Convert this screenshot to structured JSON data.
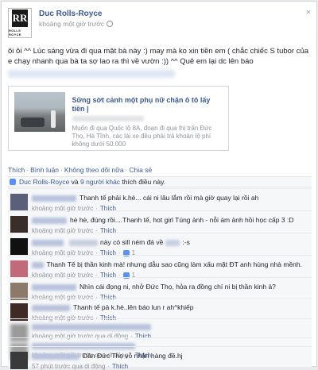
{
  "post": {
    "author": "Duc Rolls-Royce",
    "logo_text": "ROLLS ROYCE",
    "logo_monogram": "RR",
    "time": "khoảng một giờ trước",
    "close_glyph": "×",
    "text": "ôi ôi ^^ Lúc sáng vừa đi qua mặt bà này :) may mà ko xin tiền em ( chắc chiếc S tubor của e chạy nhanh qua bà ta sợ lao ra thì về vườn :)) ^^ Quê em lại dc lên báo",
    "link": {
      "title": "Sững sờt cảnh một phụ nữ chặn ô tô lấy tiền |",
      "description": "Muốn đi qua Quốc lộ 8A, đoạn đi qua thị trấn Đức Thọ, Hà Tĩnh, các lái xe đều phải trả khoản lộ phí không dưới 50.000"
    }
  },
  "actions": {
    "like": "Thích",
    "comment": "Bình luận",
    "unfollow": "Không theo dõi nữa",
    "share": "Chia sẻ",
    "sep": "·"
  },
  "likes": {
    "text_author": "Duc Rolls-Royce",
    "text_mid": "và",
    "text_others": "9 người khác",
    "text_end": "thích điều này."
  },
  "comments": [
    {
      "text": "Thanh tế phải k.hè... cái ni lâu lắm rồi mà giờ quay lại rồi ah",
      "time": "khoảng một giờ trước",
      "like": "Thích",
      "av": "#5c5f7a"
    },
    {
      "text": "hè hè, đúng rồi....Thanh tế, hot girl Túng ảnh - nỗi ám ảnh hồi học cấp 3 :D",
      "time": "khoảng một giờ trước",
      "like": "Thích",
      "av": "#3a2e28"
    },
    {
      "text": "này có sill ném đá về",
      "text_end": ":-s",
      "time": "khoảng một giờ trước",
      "like": "Thích",
      "likes": "1",
      "av": "#111"
    },
    {
      "text": "Thanh Tế bị thần kinh mà! nhưng dẫu sao cũng làm xấu mặt ĐT anh hùng nhà mềnh.",
      "time": "khoảng một giờ trước",
      "like": "Thích",
      "likes": "1",
      "av": "#c26a7a"
    },
    {
      "text": "Nhìn cái đọng ni, nhở Đức Thọ, hỏa ra đồng chí ni bị thần kinh ả?",
      "time": "khoảng một giờ trước",
      "like": "Thích",
      "av": "#8b7a6a"
    },
    {
      "text": "Thanh tế pả k.hè..lên báo lun r ah^khiếp",
      "time": "khoảng một giờ trước",
      "like": "Thích",
      "av": "#402a26"
    },
    {
      "text": "",
      "time": "khoảng một giờ trước qua di động",
      "like": "Thích",
      "av": "#9a9a9a"
    },
    {
      "text": "",
      "time": "khoảng một giờ trước qua di động",
      "like": "Thích",
      "av": "#a0a0a0"
    },
    {
      "text": "Dân Đức Thọ vỗ nhận hàng đề.hj",
      "time": "57 phút trước qua di động",
      "like": "Thích",
      "av": "#3a3a3a"
    }
  ]
}
